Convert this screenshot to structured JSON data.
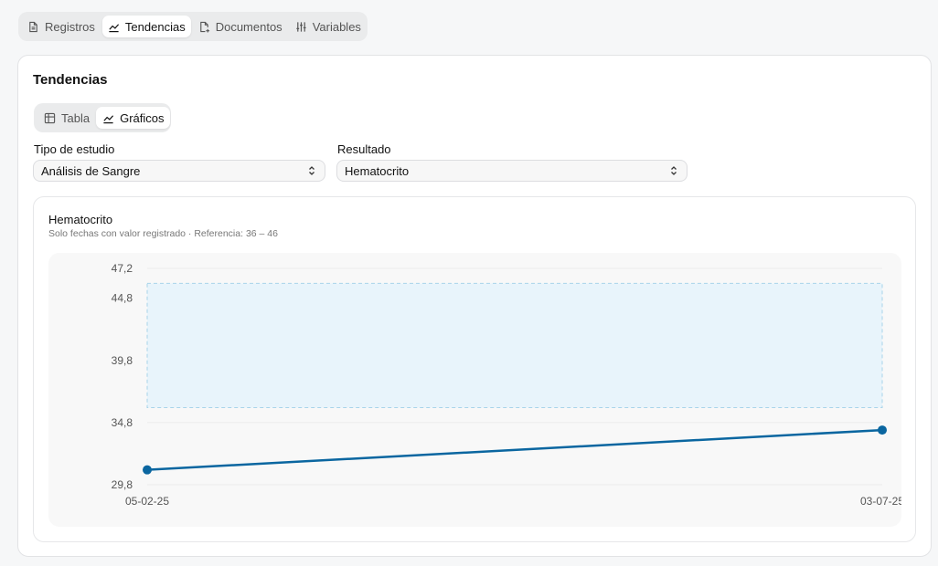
{
  "top_tabs": [
    {
      "label": "Registros",
      "icon": "file-text-icon",
      "active": false
    },
    {
      "label": "Tendencias",
      "icon": "trend-icon",
      "active": true
    },
    {
      "label": "Documentos",
      "icon": "file-plus-icon",
      "active": false
    },
    {
      "label": "Variables",
      "icon": "sliders-icon",
      "active": false
    }
  ],
  "card": {
    "title": "Tendencias"
  },
  "view_tabs": [
    {
      "label": "Tabla",
      "icon": "table-icon",
      "active": false
    },
    {
      "label": "Gráficos",
      "icon": "trend-icon",
      "active": true
    }
  ],
  "filters": {
    "study_type": {
      "label": "Tipo de estudio",
      "value": "Análisis de Sangre"
    },
    "result": {
      "label": "Resultado",
      "value": "Hematocrito"
    }
  },
  "chart": {
    "title": "Hematocrito",
    "subtitle": "Solo fechas con valor registrado · Referencia: 36 – 46"
  },
  "colors": {
    "line": "#0a66a0",
    "reference_fill": "#e8f4fb",
    "reference_border": "#a9d4ea"
  },
  "chart_data": {
    "type": "line",
    "x": [
      "05-02-25",
      "03-07-25"
    ],
    "series": [
      {
        "values": [
          31.0,
          34.2
        ]
      }
    ],
    "yticks": [
      "47,2",
      "44,8",
      "39,8",
      "34,8",
      "29,8"
    ],
    "ytick_values": [
      47.2,
      44.8,
      39.8,
      34.8,
      29.8
    ],
    "ylim": [
      29.8,
      47.2
    ],
    "reference_range": [
      36,
      46
    ],
    "grid": true
  }
}
